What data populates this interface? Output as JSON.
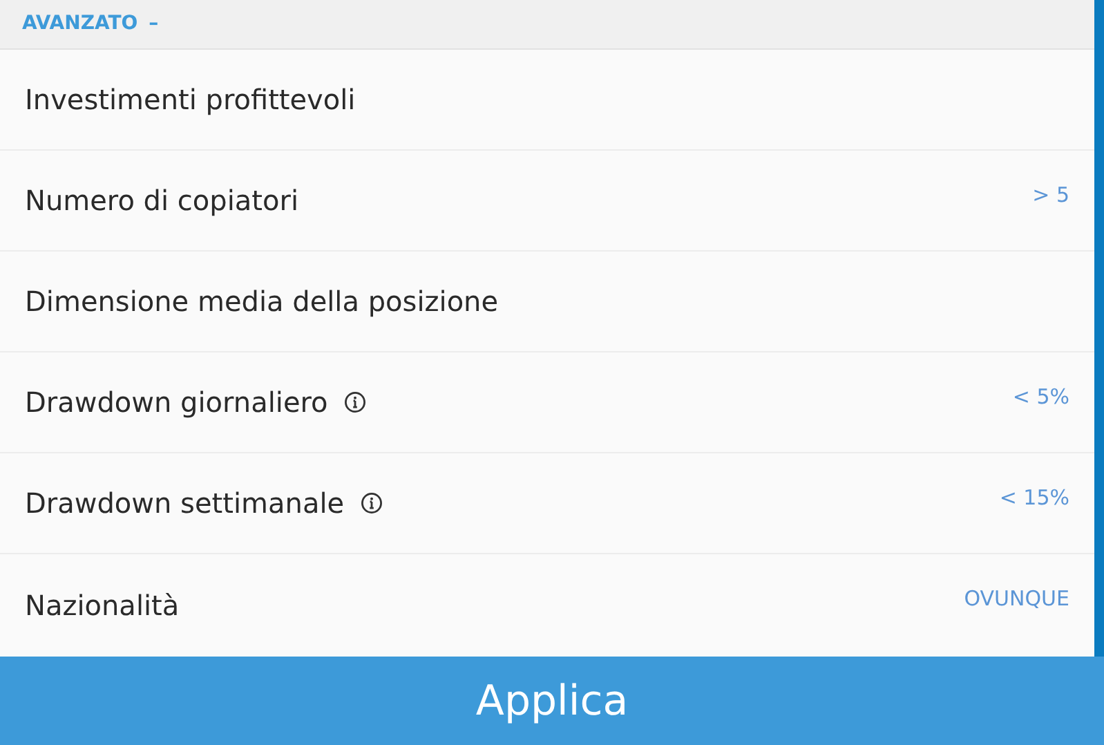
{
  "section": {
    "title": "AVANZATO",
    "toggle": "–"
  },
  "filters": [
    {
      "label": "Investimenti profittevoli",
      "info": false
    },
    {
      "label": "Numero di copiatori",
      "info": false,
      "value": "> 5"
    },
    {
      "label": "Dimensione media della posizione",
      "info": false
    },
    {
      "label": "Drawdown giornaliero",
      "info": true,
      "value": "< 5%"
    },
    {
      "label": "Drawdown settimanale",
      "info": true,
      "value": "< 15%"
    },
    {
      "label": "Nazionalità",
      "info": false,
      "value": "OVUNQUE"
    }
  ],
  "apply_button": "Applica"
}
